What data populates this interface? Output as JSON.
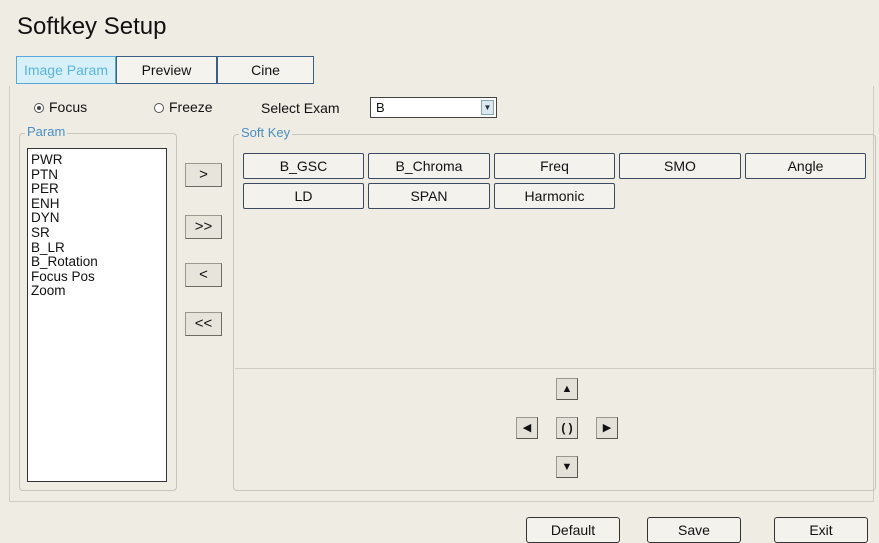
{
  "title": "Softkey Setup",
  "tabs": [
    {
      "label": "Image Param",
      "active": true
    },
    {
      "label": "Preview",
      "active": false
    },
    {
      "label": "Cine",
      "active": false
    }
  ],
  "mode": {
    "focus_label": "Focus",
    "freeze_label": "Freeze",
    "selected": "Focus"
  },
  "select_exam": {
    "label": "Select Exam",
    "value": "B"
  },
  "param_group": {
    "legend": "Param",
    "items": [
      "PWR",
      "PTN",
      "PER",
      "ENH",
      "DYN",
      "SR",
      "B_LR",
      "B_Rotation",
      "Focus Pos",
      "Zoom"
    ]
  },
  "move_buttons": [
    ">",
    ">>",
    "<",
    "<<"
  ],
  "softkey_group": {
    "legend": "Soft Key",
    "row1": [
      "B_GSC",
      "B_Chroma",
      "Freq",
      "SMO",
      "Angle"
    ],
    "row2": [
      "LD",
      "SPAN",
      "Harmonic"
    ]
  },
  "nav": {
    "up": "up-triangle-icon",
    "down": "down-triangle-icon",
    "left": "left-triangle-icon",
    "right": "right-triangle-icon",
    "center": "rotate-icon"
  },
  "footer": {
    "default_label": "Default",
    "save_label": "Save",
    "exit_label": "Exit"
  },
  "colors": {
    "background": "#efece4",
    "accent": "#4a8fc6",
    "active_tab_bg": "#d8f0fa"
  }
}
